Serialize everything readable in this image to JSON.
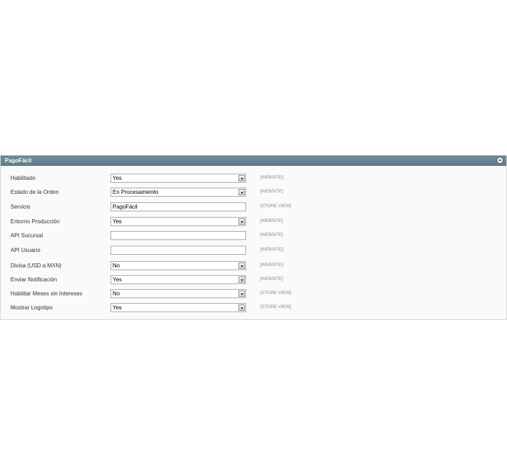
{
  "section": {
    "title": "PagoFácil"
  },
  "fields": [
    {
      "label": "Habilitado",
      "type": "select",
      "value": "Yes",
      "scope": "[WEBSITE]"
    },
    {
      "label": "Estado de la Orden",
      "type": "select",
      "value": "En Procesamiento",
      "scope": "[WEBSITE]"
    },
    {
      "label": "Servicio",
      "type": "text",
      "value": "PagoFácil",
      "scope": "[STORE VIEW]"
    },
    {
      "label": "Entorno Producción",
      "type": "select",
      "value": "Yes",
      "scope": "[WEBSITE]"
    },
    {
      "label": "API Sucursal",
      "type": "text",
      "value": "",
      "scope": "[WEBSITE]"
    },
    {
      "label": "API Usuario",
      "type": "text",
      "value": "",
      "scope": "[WEBSITE]"
    },
    {
      "label": "Divisa (USD a MXN)",
      "type": "select",
      "value": "No",
      "scope": "[WEBSITE]"
    },
    {
      "label": "Enviar Notificación",
      "type": "select",
      "value": "Yes",
      "scope": "[WEBSITE]"
    },
    {
      "label": "Habilitar Meses sin Intereses",
      "type": "select",
      "value": "No",
      "scope": "[STORE VIEW]"
    },
    {
      "label": "Mostrar Logotipo",
      "type": "select",
      "value": "Yes",
      "scope": "[STORE VIEW]"
    }
  ]
}
